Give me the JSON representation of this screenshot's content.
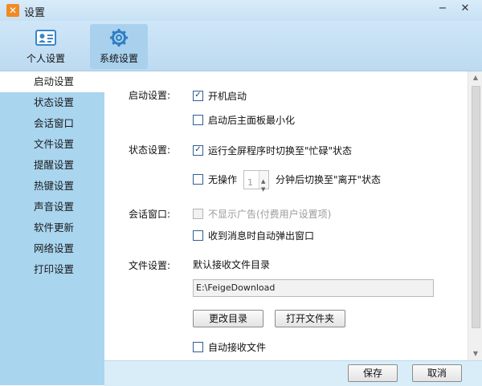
{
  "window": {
    "title": "设置"
  },
  "toolbar": {
    "personal_label": "个人设置",
    "system_label": "系统设置"
  },
  "sidebar": {
    "items": [
      {
        "label": "启动设置"
      },
      {
        "label": "状态设置"
      },
      {
        "label": "会话窗口"
      },
      {
        "label": "文件设置"
      },
      {
        "label": "提醒设置"
      },
      {
        "label": "热键设置"
      },
      {
        "label": "声音设置"
      },
      {
        "label": "软件更新"
      },
      {
        "label": "网络设置"
      },
      {
        "label": "打印设置"
      }
    ]
  },
  "startup": {
    "label": "启动设置:",
    "auto_start": {
      "label": "开机启动",
      "checked": true
    },
    "minimize": {
      "label": "启动后主面板最小化",
      "checked": false
    }
  },
  "status": {
    "label": "状态设置:",
    "busy_fullscreen": {
      "label": "运行全屏程序时切换至\"忙碌\"状态",
      "checked": true
    },
    "idle_prefix": "无操作",
    "idle_minutes": "1",
    "idle_suffix": "分钟后切换至\"离开\"状态",
    "idle_checked": false
  },
  "chat": {
    "label": "会话窗口:",
    "no_ads": {
      "label": "不显示广告(付费用户设置项)",
      "checked": false,
      "disabled": true
    },
    "popup": {
      "label": "收到消息时自动弹出窗口",
      "checked": false
    }
  },
  "files": {
    "label": "文件设置:",
    "dir_label": "默认接收文件目录",
    "dir_value": "E:\\FeigeDownload",
    "change_dir_button": "更改目录",
    "open_folder_button": "打开文件夹",
    "auto_receive": {
      "label": "自动接收文件",
      "checked": false
    }
  },
  "footer": {
    "save_button": "保存",
    "cancel_button": "取消"
  },
  "colors": {
    "sidebar_bg": "#a9d5ef",
    "toolbar_bg": "#c7e1f5",
    "selected_tab": "#a9d1ee"
  }
}
